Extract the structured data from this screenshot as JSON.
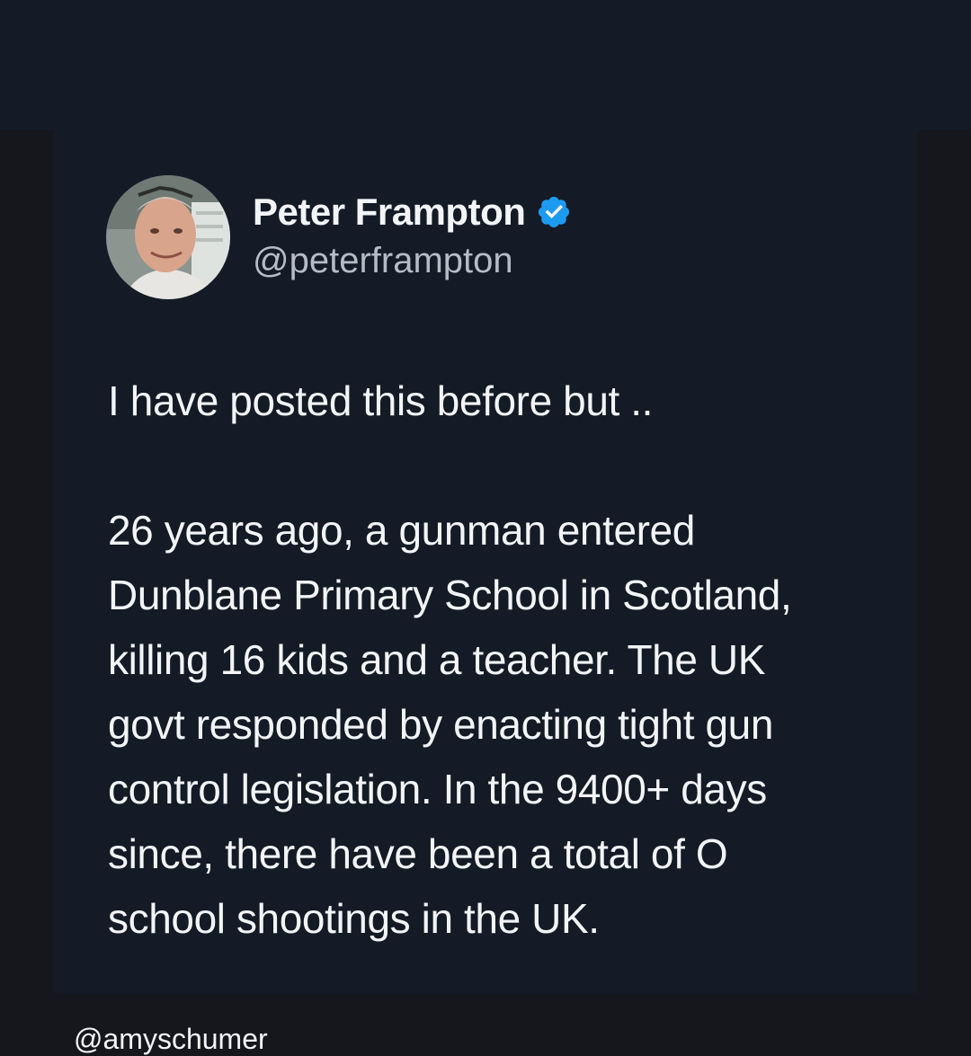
{
  "tweet": {
    "display_name": "Peter Frampton",
    "handle": "@peterframpton",
    "verified": true,
    "text": "I have posted this before but ..\n\n26 years ago, a gunman entered\nDunblane Primary School in Scotland,\nkilling 16 kids and a teacher. The UK\ngovt responded by enacting tight gun\ncontrol legislation. In the 9400+ days\nsince, there have been a total of O\nschool shootings in the UK."
  },
  "credit": "@amyschumer",
  "icons": {
    "avatar": "profile-photo",
    "verified": "verified-badge-icon"
  },
  "colors": {
    "page_background": "#16171c",
    "card_background": "#141a26",
    "text_primary": "#f2f4f7",
    "text_secondary": "#b6bcc6",
    "verified_blue": "#1d9bf0"
  }
}
